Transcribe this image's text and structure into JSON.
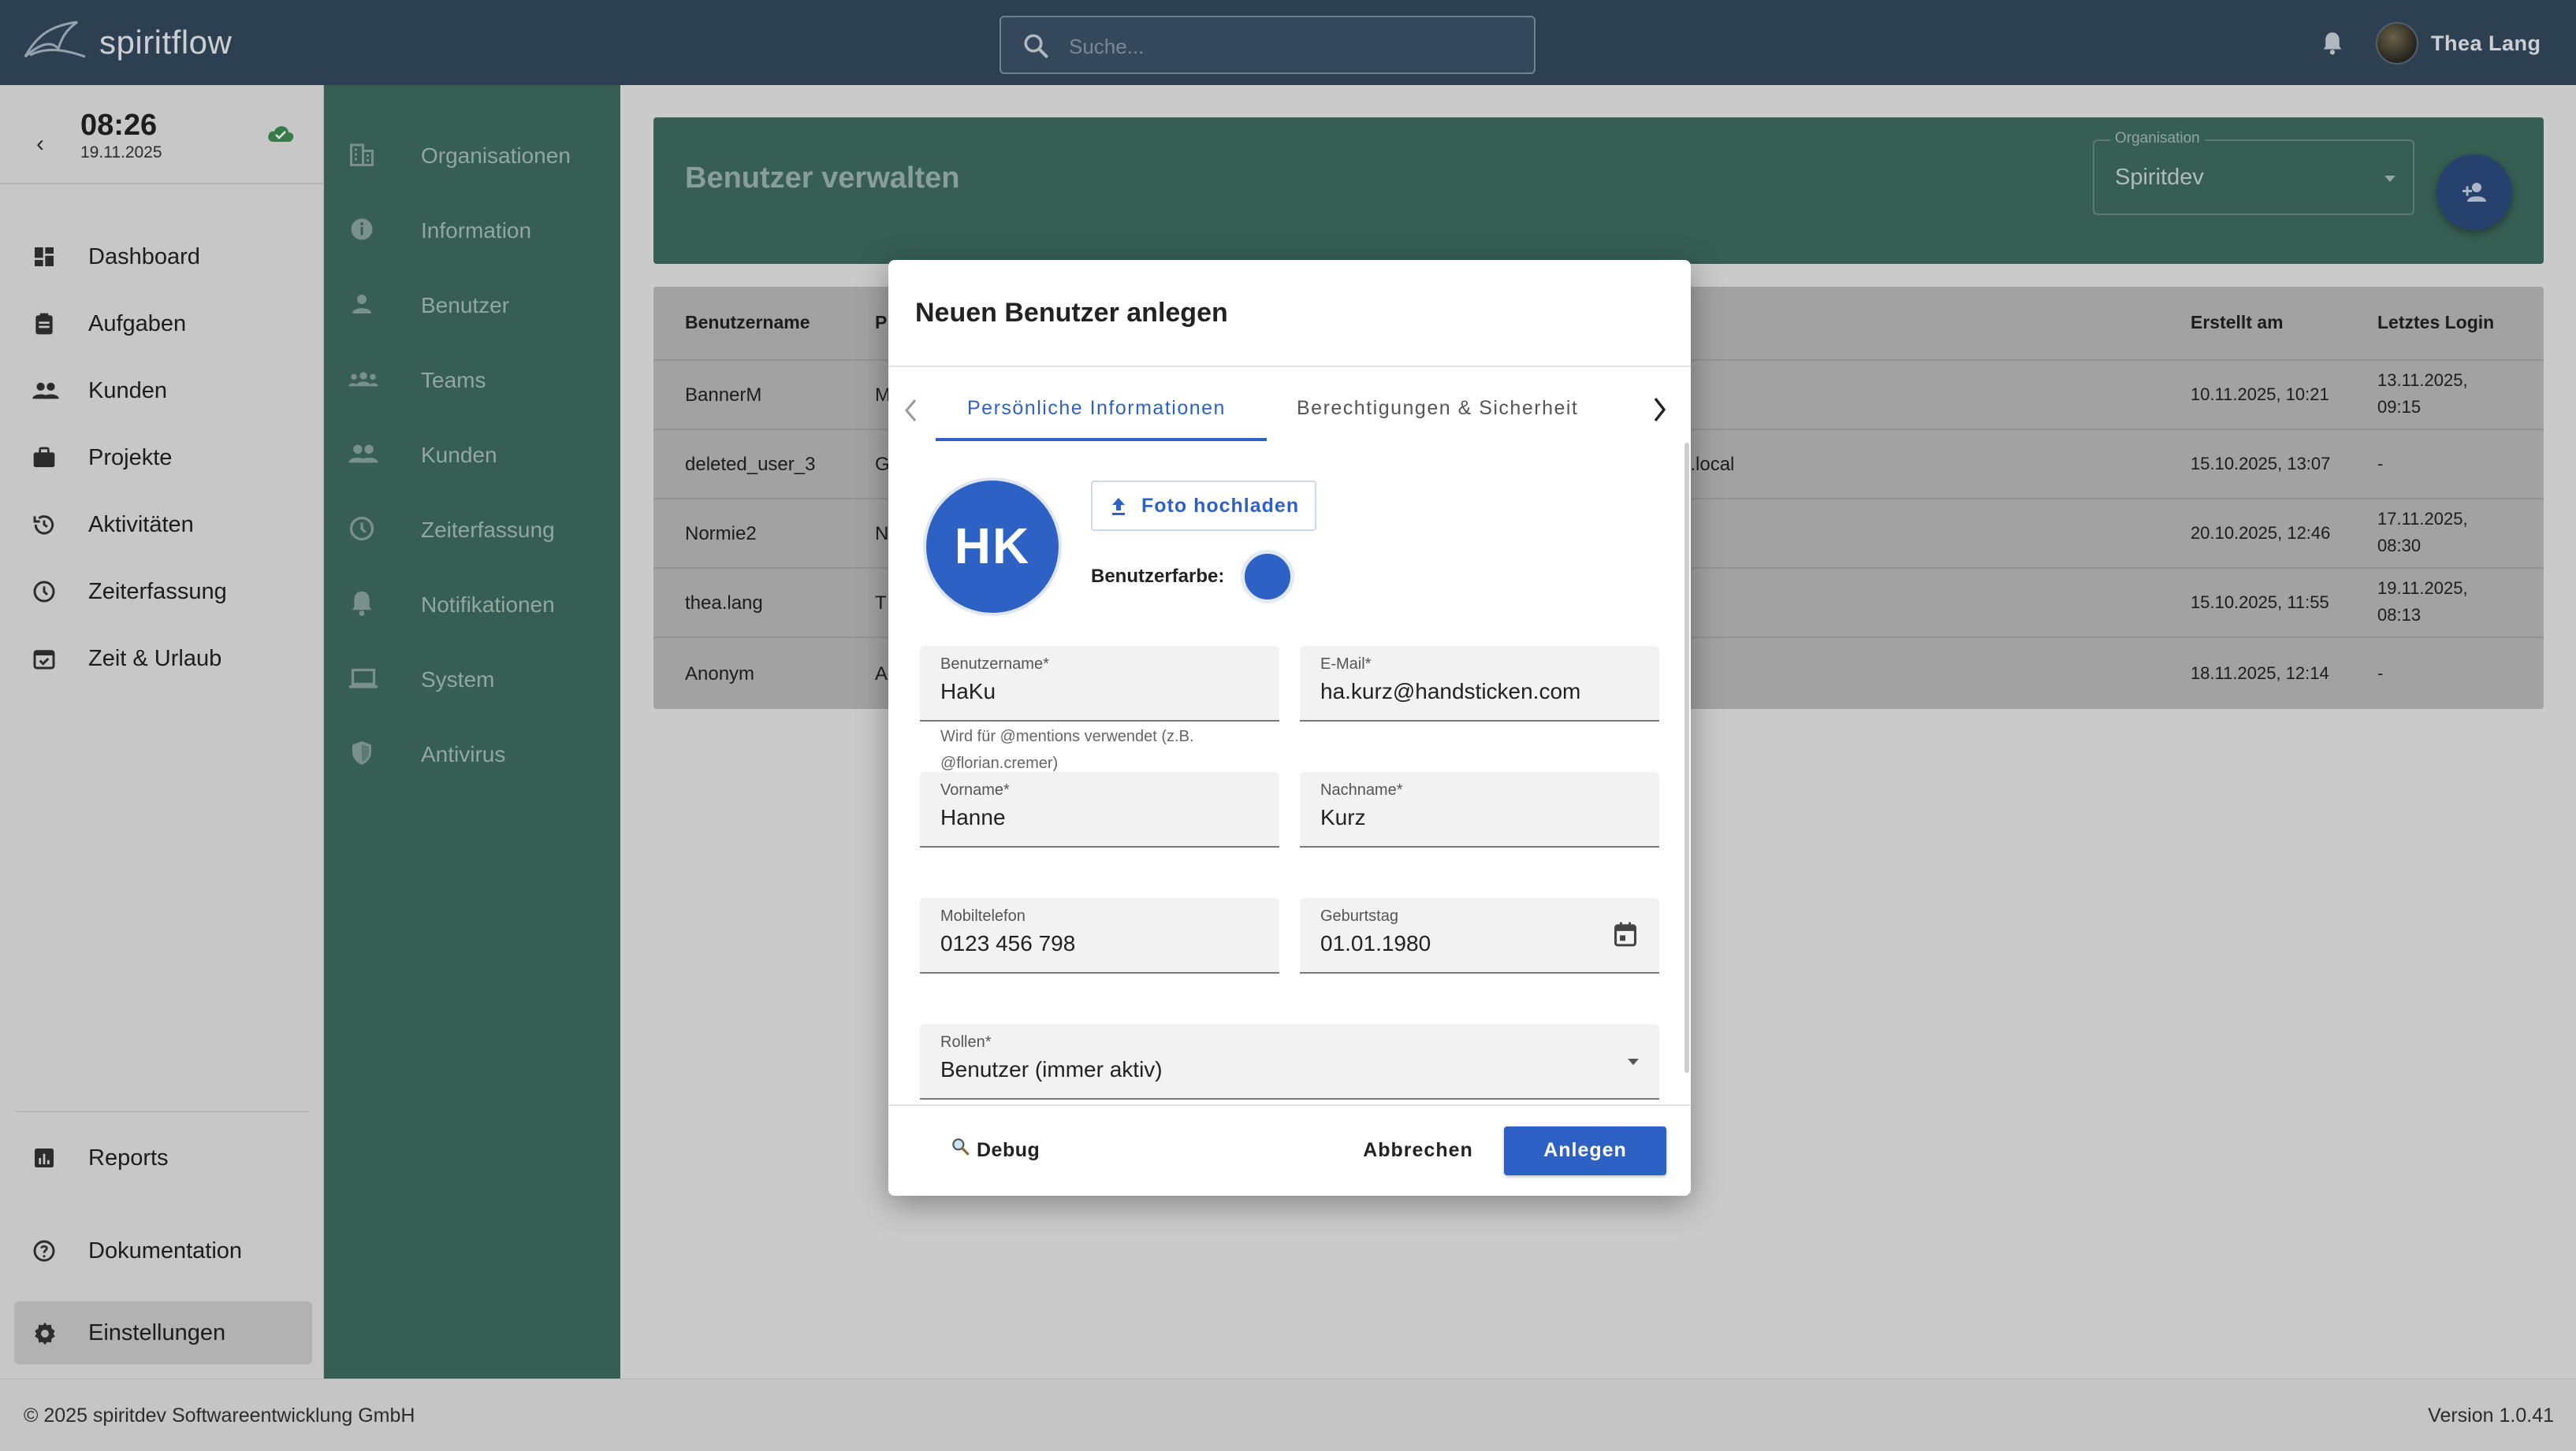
{
  "app": {
    "name": "spiritflow"
  },
  "search": {
    "placeholder": "Suche..."
  },
  "user": {
    "name": "Thea Lang"
  },
  "clock": {
    "time": "08:26",
    "date": "19.11.2025"
  },
  "nav": {
    "items": [
      {
        "label": "Dashboard",
        "icon": "dashboard-icon"
      },
      {
        "label": "Aufgaben",
        "icon": "clipboard-icon"
      },
      {
        "label": "Kunden",
        "icon": "people-icon"
      },
      {
        "label": "Projekte",
        "icon": "briefcase-icon"
      },
      {
        "label": "Aktivitäten",
        "icon": "history-icon"
      },
      {
        "label": "Zeiterfassung",
        "icon": "clock-icon"
      },
      {
        "label": "Zeit & Urlaub",
        "icon": "calendar-check-icon"
      }
    ],
    "bottom": [
      {
        "label": "Reports",
        "icon": "chart-icon"
      },
      {
        "label": "Dokumentation",
        "icon": "help-icon"
      },
      {
        "label": "Einstellungen",
        "icon": "gear-icon"
      }
    ]
  },
  "settings_nav": {
    "items": [
      {
        "label": "Organisationen",
        "icon": "building-icon"
      },
      {
        "label": "Information",
        "icon": "info-icon"
      },
      {
        "label": "Benutzer",
        "icon": "person-icon"
      },
      {
        "label": "Teams",
        "icon": "group-icon"
      },
      {
        "label": "Kunden",
        "icon": "people-icon"
      },
      {
        "label": "Zeiterfassung",
        "icon": "clock-icon"
      },
      {
        "label": "Notifikationen",
        "icon": "bell-icon"
      },
      {
        "label": "System",
        "icon": "laptop-icon"
      },
      {
        "label": "Antivirus",
        "icon": "shield-icon"
      }
    ]
  },
  "page": {
    "title": "Benutzer verwalten",
    "org_label": "Organisation",
    "org_value": "Spiritdev"
  },
  "table": {
    "headers": {
      "username": "Benutzername",
      "p": "P",
      "created": "Erstellt am",
      "last_login": "Letztes Login"
    },
    "rows": [
      {
        "username": "BannerM",
        "p": "M",
        "email": "",
        "created": "10.11.2025, 10:21",
        "last1": "13.11.2025,",
        "last2": "09:15"
      },
      {
        "username": "deleted_user_3",
        "p": "G",
        "email": "d.local",
        "created": "15.10.2025, 13:07",
        "last1": "-",
        "last2": ""
      },
      {
        "username": "Normie2",
        "p": "N",
        "email": "",
        "created": "20.10.2025, 12:46",
        "last1": "17.11.2025,",
        "last2": "08:30"
      },
      {
        "username": "thea.lang",
        "p": "T",
        "email": "",
        "created": "15.10.2025, 11:55",
        "last1": "19.11.2025,",
        "last2": "08:13"
      },
      {
        "username": "Anonym",
        "p": "A",
        "email": "",
        "created": "18.11.2025, 12:14",
        "last1": "-",
        "last2": ""
      }
    ]
  },
  "dialog": {
    "title": "Neuen Benutzer anlegen",
    "tabs": [
      "Persönliche Informationen",
      "Berechtigungen & Sicherheit"
    ],
    "avatar_initials": "HK",
    "upload_label": "Foto hochladen",
    "color_label": "Benutzerfarbe:",
    "user_color": "#2d62c4",
    "fields": {
      "username": {
        "label": "Benutzername*",
        "value": "HaKu",
        "hint1": "Wird für @mentions verwendet (z.B.",
        "hint2": "@florian.cremer)"
      },
      "email": {
        "label": "E-Mail*",
        "value": "ha.kurz@handsticken.com"
      },
      "firstname": {
        "label": "Vorname*",
        "value": "Hanne"
      },
      "lastname": {
        "label": "Nachname*",
        "value": "Kurz"
      },
      "mobile": {
        "label": "Mobiltelefon",
        "value": "0123 456 798"
      },
      "birthday": {
        "label": "Geburtstag",
        "value": "01.01.1980"
      },
      "roles": {
        "label": "Rollen*",
        "value": "Benutzer (immer aktiv)"
      }
    },
    "debug_label": "Debug",
    "cancel_label": "Abbrechen",
    "create_label": "Anlegen"
  },
  "footer": {
    "copyright": "© 2025 spiritdev Softwareentwicklung GmbH",
    "version": "Version 1.0.41"
  }
}
